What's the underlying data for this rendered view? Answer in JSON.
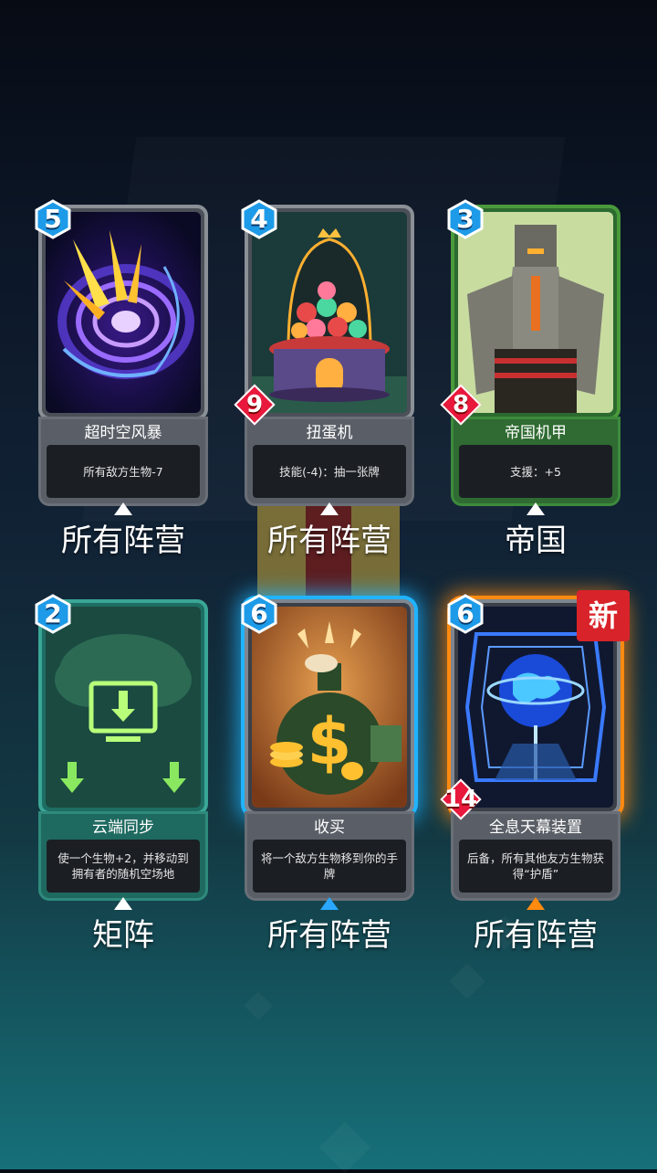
{
  "cards": [
    {
      "cost": "5",
      "power": null,
      "name": "超时空风暴",
      "description": "所有敌方生物-7",
      "faction": "所有阵营",
      "art_icon": "vortex-art",
      "frame": "gray"
    },
    {
      "cost": "4",
      "power": "9",
      "name": "扭蛋机",
      "description": "技能(-4)：抽一张牌",
      "faction": "所有阵营",
      "art_icon": "gacha-machine-art",
      "frame": "gray"
    },
    {
      "cost": "3",
      "power": "8",
      "name": "帝国机甲",
      "description": "支援：+5",
      "faction": "帝国",
      "art_icon": "mech-robot-art",
      "frame": "green"
    },
    {
      "cost": "2",
      "power": null,
      "name": "云端同步",
      "description": "使一个生物+2，并移动到拥有者的随机空场地",
      "faction": "矩阵",
      "art_icon": "cloud-download-art",
      "frame": "teal"
    },
    {
      "cost": "6",
      "power": null,
      "name": "收买",
      "description": "将一个敌方生物移到你的手牌",
      "faction": "所有阵营",
      "art_icon": "money-bag-art",
      "frame": "blue",
      "selected": true
    },
    {
      "cost": "6",
      "power": "14",
      "name": "全息天幕装置",
      "description": "后备，所有其他友方生物获得“护盾”",
      "faction": "所有阵营",
      "art_icon": "hologram-globe-art",
      "frame": "orange",
      "badge": "新"
    }
  ],
  "colors": {
    "cost_badge": "#1e9be8",
    "power_gem": "#e8193c",
    "selected_glow": "#20b4ff",
    "new_glow": "#ff8a10",
    "new_badge": "#d8232a"
  }
}
